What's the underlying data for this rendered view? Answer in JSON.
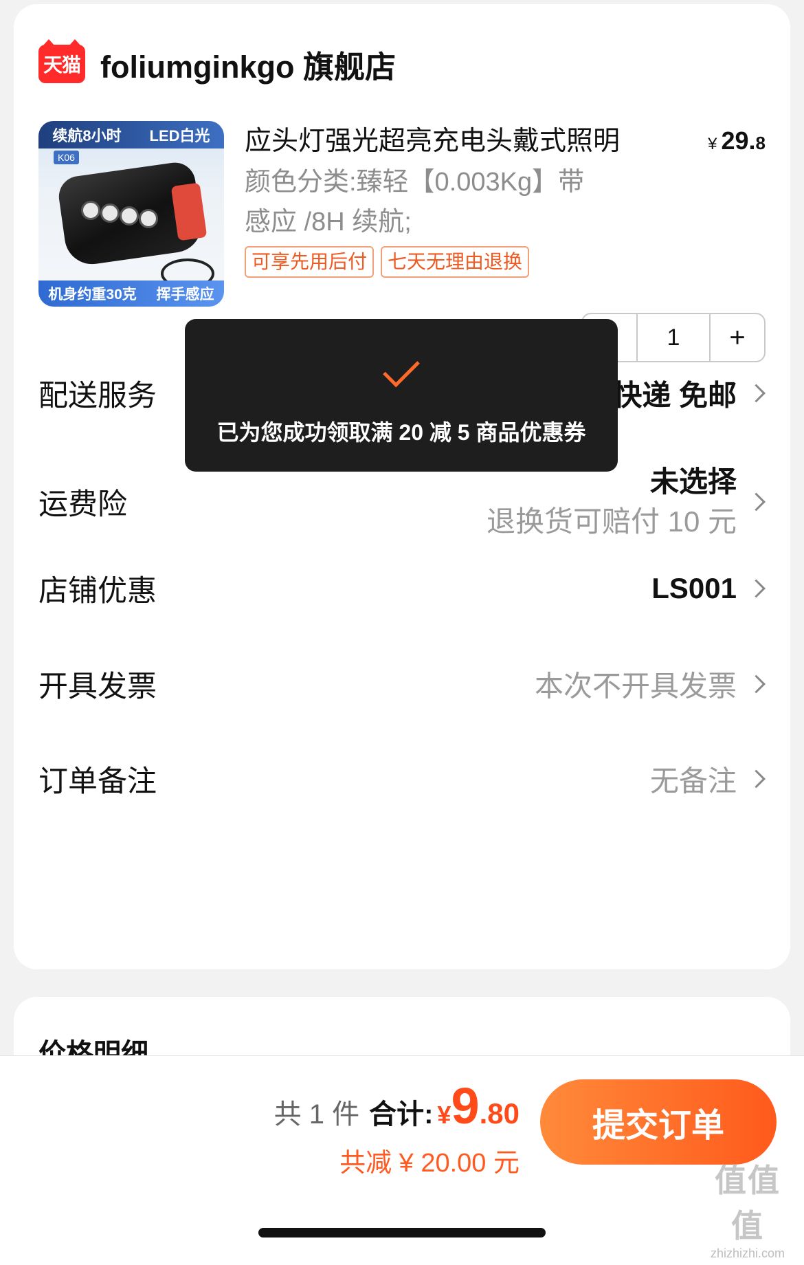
{
  "store": {
    "badge": "天猫",
    "name": "foliumginkgo 旗舰店"
  },
  "product": {
    "image": {
      "top_band_left": "续航8小时",
      "top_band_right": "LED白光",
      "model_tag": "K06",
      "bottom_band_left": "机身约重30克",
      "bottom_band_right": "挥手感应"
    },
    "title": "应头灯强光超亮充电头戴式照明",
    "price_symbol": "¥",
    "price_int": "29.",
    "price_dec": "8",
    "spec_line1": "颜色分类:臻轻【0.003Kg】带",
    "spec_line2": "感应 /8H 续航;",
    "tags": [
      "可享先用后付",
      "七天无理由退换"
    ],
    "quantity": "1",
    "minus_label": "−",
    "plus_label": "+"
  },
  "toast": {
    "text": "已为您成功领取满 20 减 5 商品优惠券"
  },
  "rows": {
    "delivery": {
      "label": "配送服务",
      "value": "快递 免邮"
    },
    "freight_insurance": {
      "label": "运费险",
      "value_line1": "未选择",
      "value_line2": "退换货可赔付 10 元"
    },
    "store_discount": {
      "label": "店铺优惠",
      "value": "LS001"
    },
    "invoice": {
      "label": "开具发票",
      "value": "本次不开具发票"
    },
    "remark": {
      "label": "订单备注",
      "value": "无备注"
    }
  },
  "price_detail": {
    "title": "价格明细"
  },
  "footer": {
    "count_text": "共 1 件",
    "sum_label": "合计:",
    "total_symbol": "¥",
    "total_int": "9",
    "total_dec": ".80",
    "discount_text": "共减 ¥ 20.00 元",
    "submit_label": "提交订单"
  },
  "watermark": {
    "glyphs": "值值值",
    "url": "zhizhizhi.com"
  },
  "colors": {
    "accent": "#ff4a1a",
    "tmall_red": "#ff2a2a",
    "toast_bg": "#1e1e1e"
  }
}
